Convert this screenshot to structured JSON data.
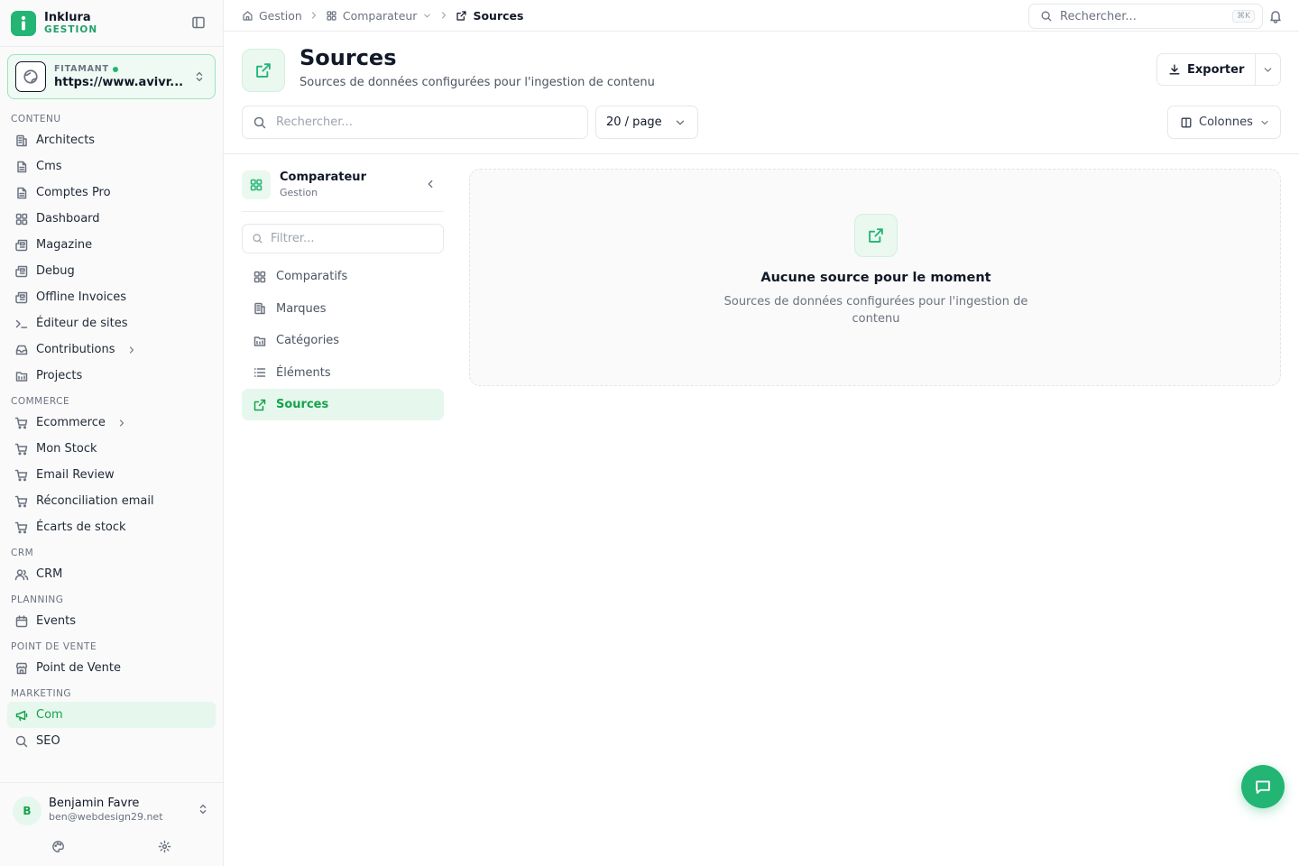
{
  "brand": {
    "name": "Inklura",
    "sub": "GESTION",
    "accent": "#22b573"
  },
  "site": {
    "tag": "FITAMANT",
    "url": "https://www.avivr..."
  },
  "nav": {
    "sections": [
      {
        "title": "CONTENU",
        "items": [
          {
            "label": "Architects",
            "icon": "building-icon"
          },
          {
            "label": "Cms",
            "icon": "document-icon"
          },
          {
            "label": "Comptes Pro",
            "icon": "document-icon"
          },
          {
            "label": "Dashboard",
            "icon": "grid-icon"
          },
          {
            "label": "Magazine",
            "icon": "newspaper-icon"
          },
          {
            "label": "Debug",
            "icon": "newspaper-icon"
          },
          {
            "label": "Offline Invoices",
            "icon": "newspaper-icon"
          },
          {
            "label": "Éditeur de sites",
            "icon": "terminal-icon"
          },
          {
            "label": "Contributions",
            "icon": "inbox-icon"
          },
          {
            "label": "Projects",
            "icon": "folder-icon"
          }
        ]
      },
      {
        "title": "COMMERCE",
        "items": [
          {
            "label": "Ecommerce",
            "icon": "cart-icon"
          },
          {
            "label": "Mon Stock",
            "icon": "cart-icon"
          },
          {
            "label": "Email Review",
            "icon": "cart-icon"
          },
          {
            "label": "Réconciliation email",
            "icon": "cart-icon"
          },
          {
            "label": "Écarts de stock",
            "icon": "cart-icon"
          }
        ]
      },
      {
        "title": "CRM",
        "items": [
          {
            "label": "CRM",
            "icon": "users-icon"
          }
        ]
      },
      {
        "title": "PLANNING",
        "items": [
          {
            "label": "Events",
            "icon": "calendar-icon"
          }
        ]
      },
      {
        "title": "POINT DE VENTE",
        "items": [
          {
            "label": "Point de Vente",
            "icon": "store-icon"
          }
        ]
      },
      {
        "title": "MARKETING",
        "items": [
          {
            "label": "Com",
            "icon": "megaphone-icon",
            "active": true
          },
          {
            "label": "SEO",
            "icon": "search-icon"
          }
        ]
      }
    ]
  },
  "user": {
    "initial": "B",
    "name": "Benjamin Favre",
    "email": "ben@webdesign29.net"
  },
  "breadcrumbs": [
    "Gestion",
    "Comparateur",
    "Sources"
  ],
  "top_search": {
    "placeholder": "Rechercher...",
    "shortcut": "⌘K"
  },
  "page": {
    "title": "Sources",
    "subtitle": "Sources de données configurées pour l'ingestion de contenu",
    "export_label": "Exporter",
    "search_placeholder": "Rechercher...",
    "per_page": "20 / page",
    "columns_label": "Colonnes"
  },
  "subnav": {
    "title": "Comparateur",
    "subtitle": "Gestion",
    "filter_placeholder": "Filtrer...",
    "items": [
      {
        "label": "Comparatifs",
        "icon": "grid-icon"
      },
      {
        "label": "Marques",
        "icon": "building-icon"
      },
      {
        "label": "Catégories",
        "icon": "folder-icon"
      },
      {
        "label": "Éléments",
        "icon": "list-icon"
      },
      {
        "label": "Sources",
        "icon": "external-link-icon",
        "active": true
      }
    ]
  },
  "empty": {
    "title": "Aucune source pour le moment",
    "description": "Sources de données configurées pour l'ingestion de contenu"
  }
}
